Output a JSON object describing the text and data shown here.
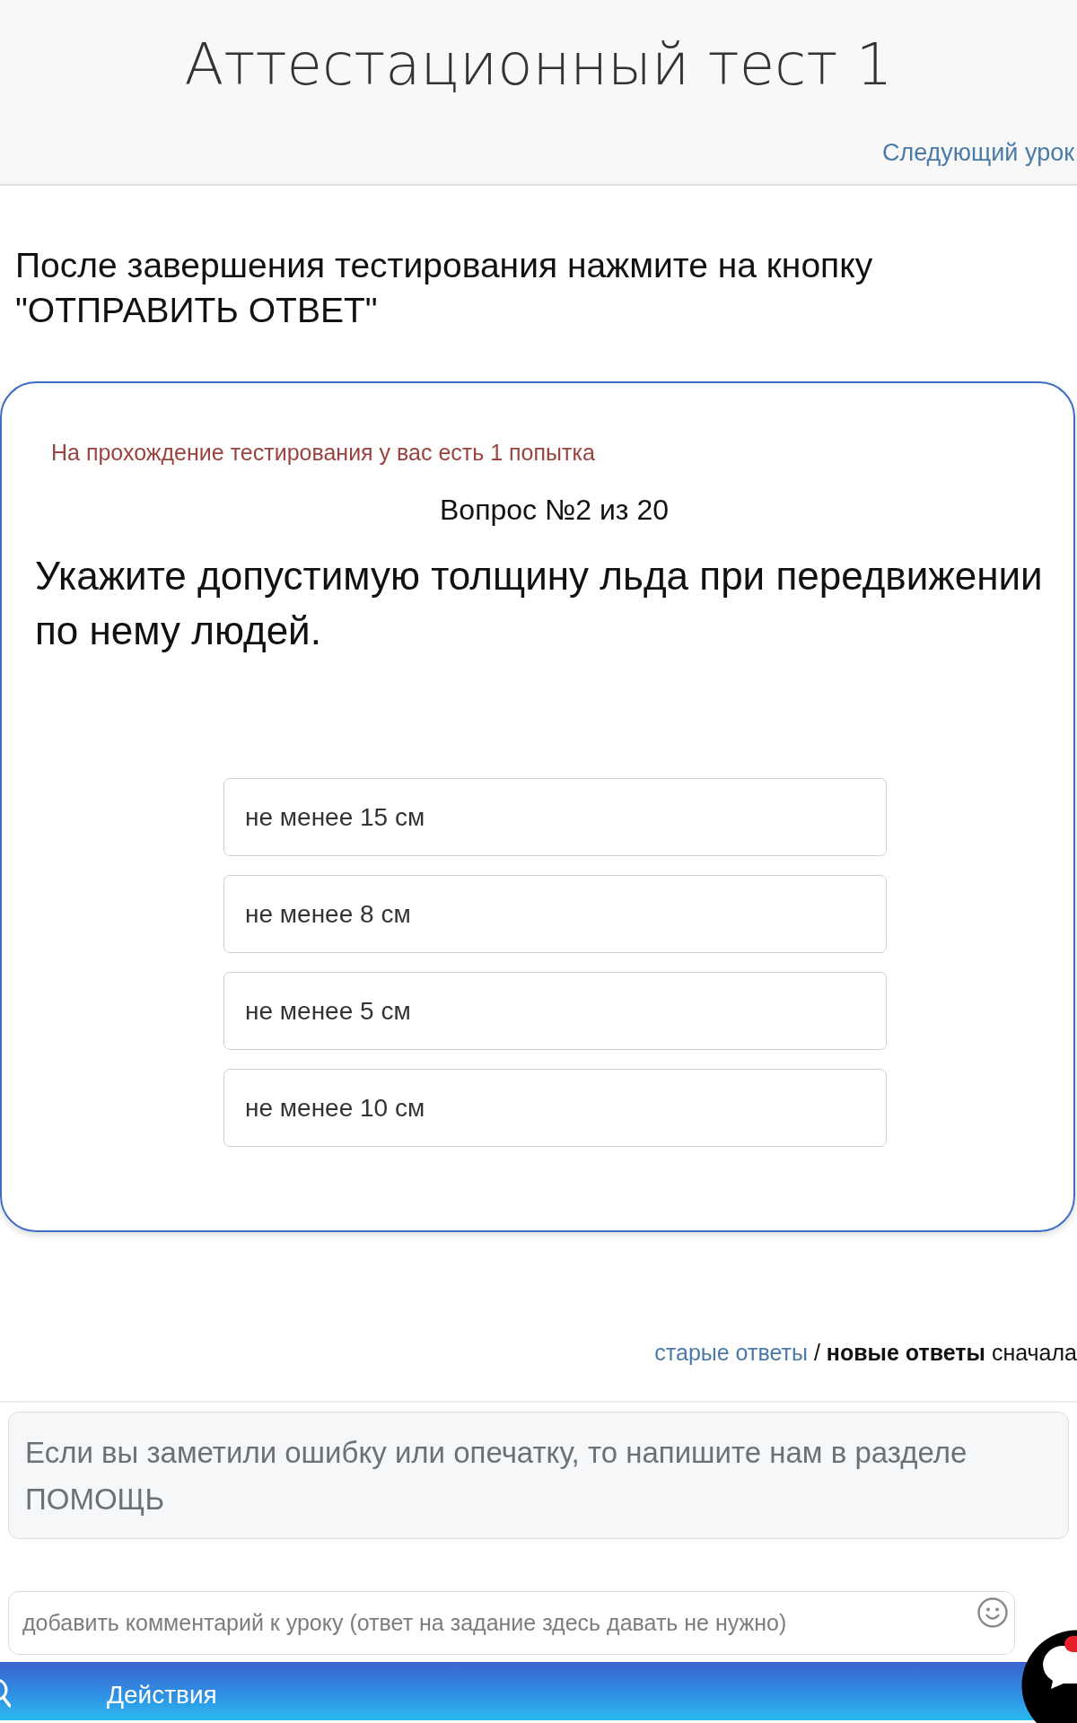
{
  "header": {
    "title": "Аттестационный тест 1",
    "next_link": "Следующий урок"
  },
  "instruction": "После завершения тестирования нажмите на кнопку \"ОТПРАВИТЬ ОТВЕТ\"",
  "quiz": {
    "attempts_note": "На прохождение тестирования у вас есть 1 попытка",
    "progress": "Вопрос №2 из 20",
    "question": "Укажите допустимую толщину льда при передвижении по нему людей.",
    "answers": [
      {
        "label": "не менее 15 см",
        "selected": false
      },
      {
        "label": "не менее 8 см",
        "selected": false
      },
      {
        "label": "не менее 5 см",
        "selected": false
      },
      {
        "label": "не менее 10 см",
        "selected": false
      }
    ]
  },
  "sort": {
    "options": [
      {
        "label": "старые ответы",
        "selected": false
      },
      {
        "label": "новые ответы",
        "selected": true
      }
    ],
    "separator": "/",
    "suffix": "сначала"
  },
  "help_notice": "Если вы заметили ошибку или опечатку, то напишите нам в разделе ПОМОЩЬ",
  "comment": {
    "placeholder": "добавить комментарий к уроку (ответ на задание здесь давать не нужно)"
  },
  "bottom_bar": {
    "label": "Действия"
  },
  "chat_button": {
    "unread": true
  }
}
